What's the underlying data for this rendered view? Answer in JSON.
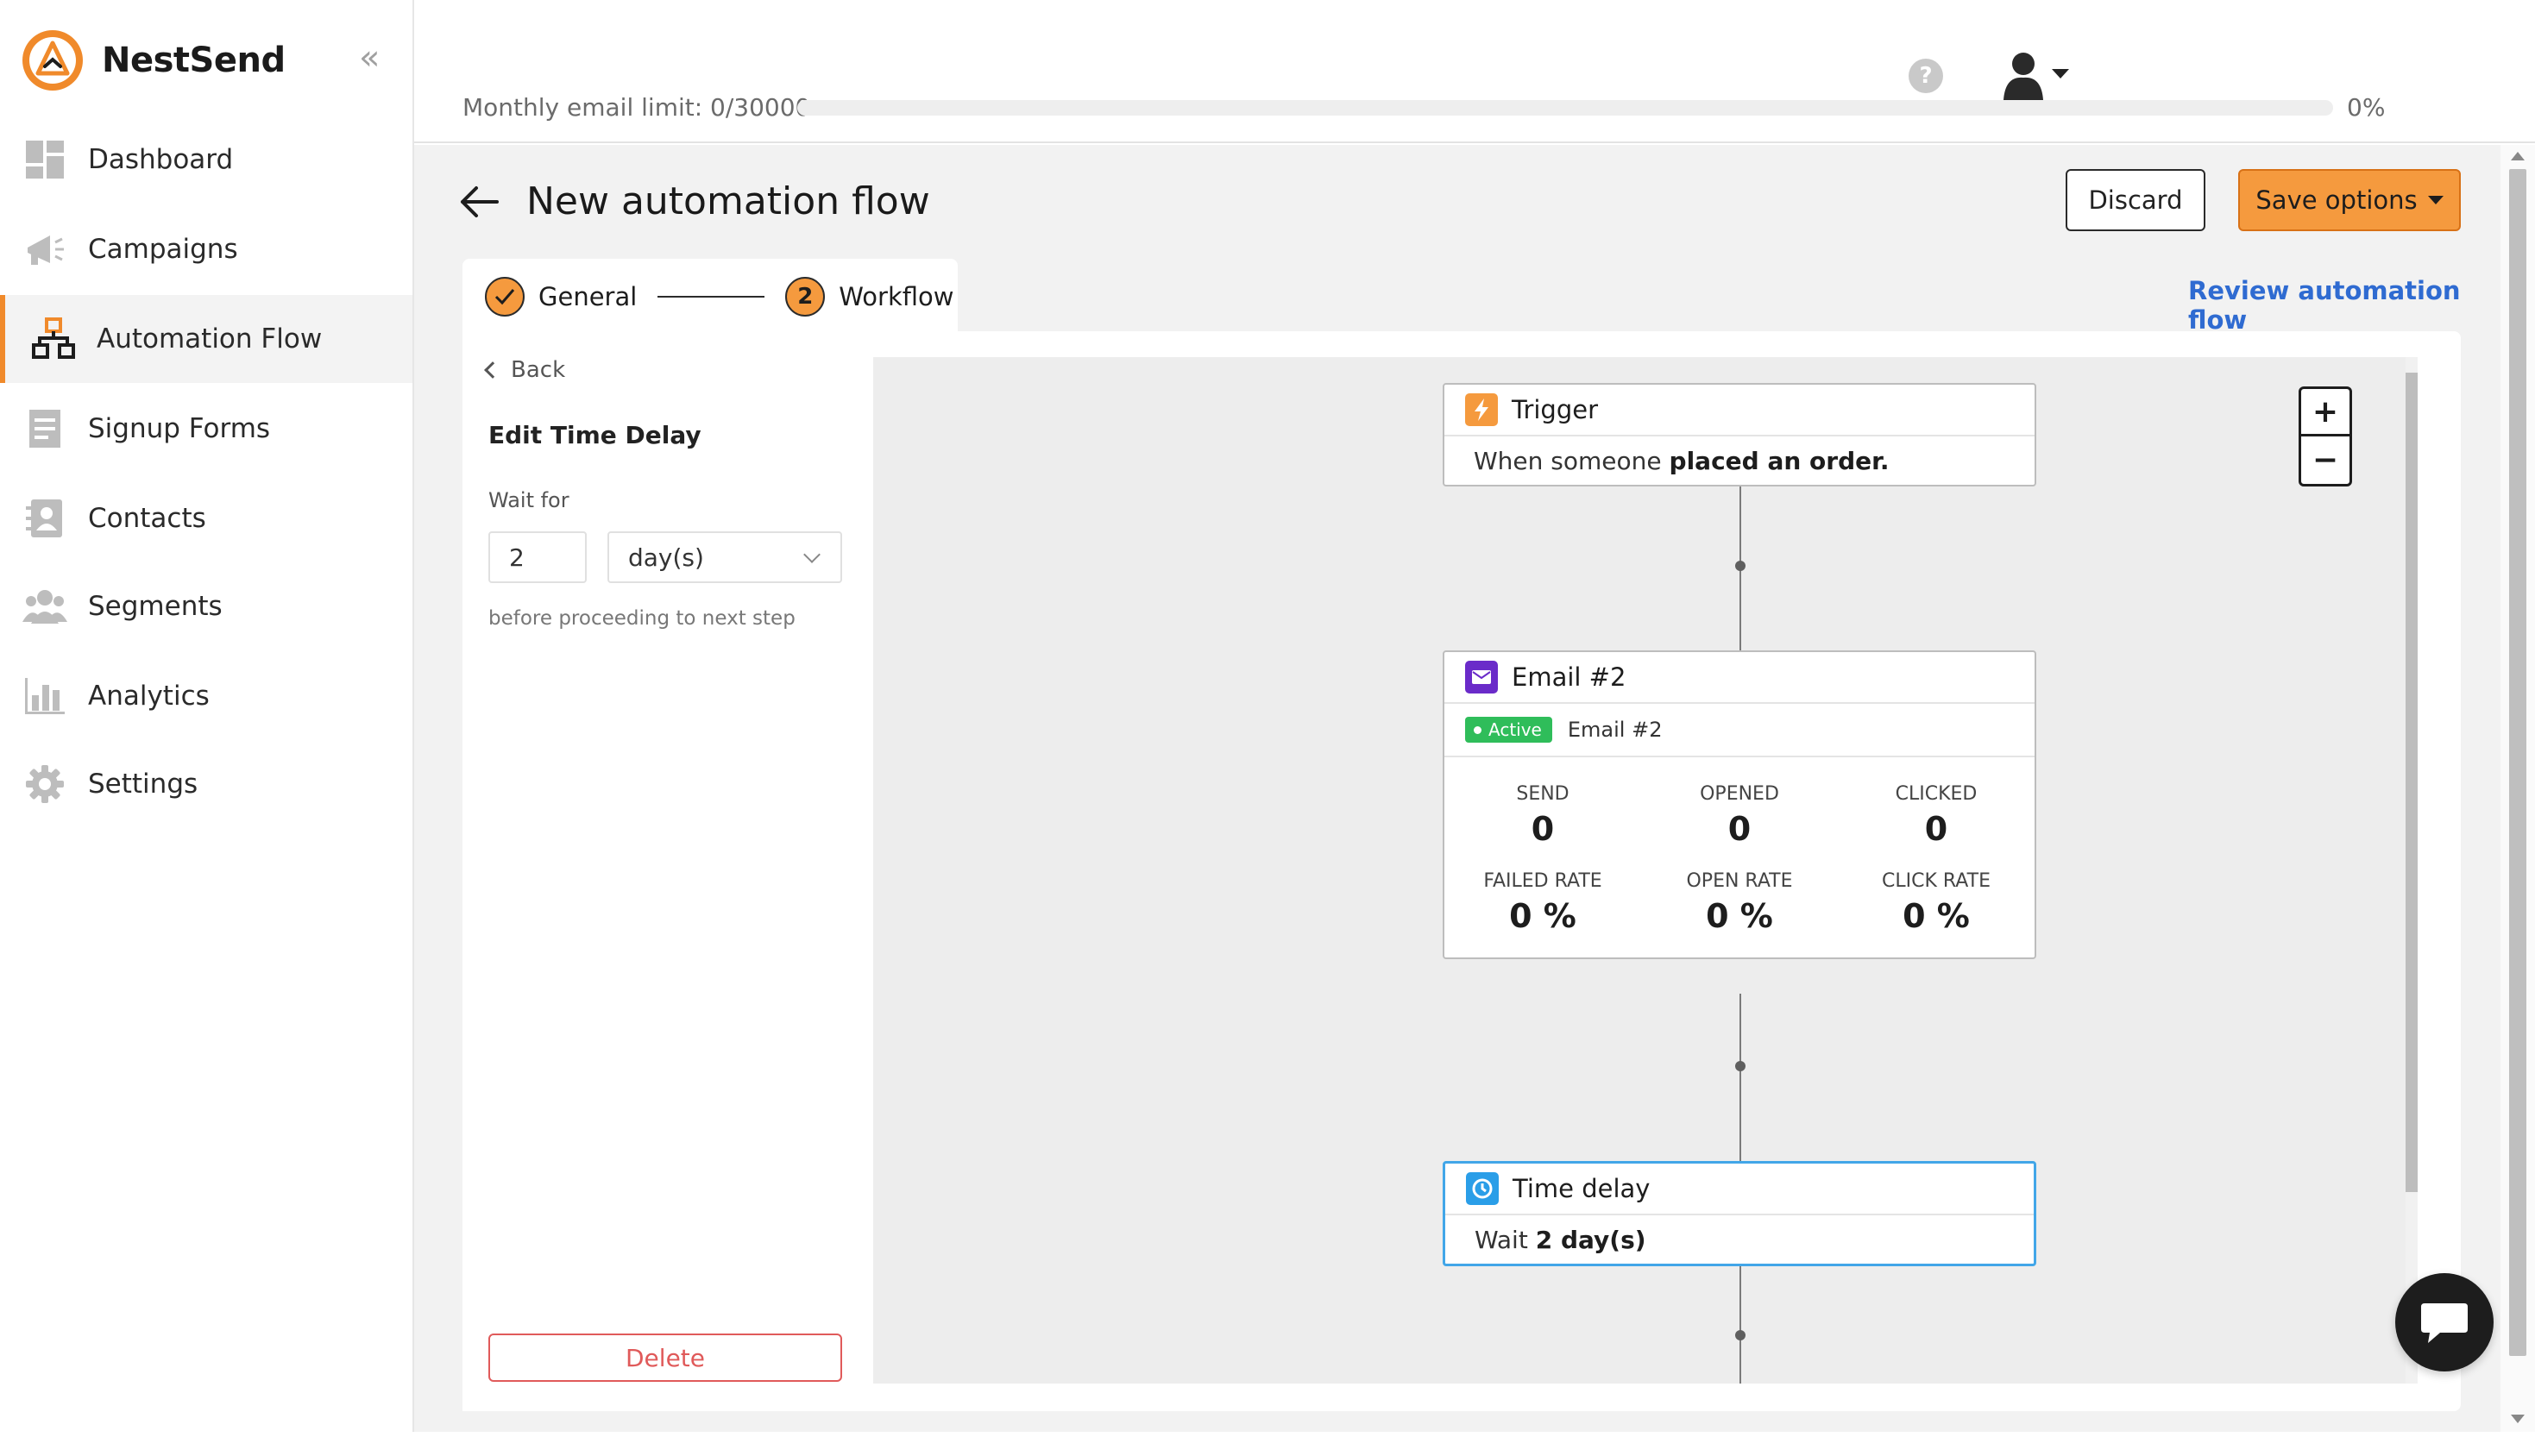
{
  "brand": {
    "name": "NestSend",
    "collapse_icon": "«"
  },
  "sidebar": {
    "items": [
      {
        "label": "Dashboard",
        "icon": "dashboard-icon",
        "active": false
      },
      {
        "label": "Campaigns",
        "icon": "megaphone-icon",
        "active": false
      },
      {
        "label": "Automation Flow",
        "icon": "flowchart-icon",
        "active": true
      },
      {
        "label": "Signup Forms",
        "icon": "form-icon",
        "active": false
      },
      {
        "label": "Contacts",
        "icon": "contact-book-icon",
        "active": false
      },
      {
        "label": "Segments",
        "icon": "users-icon",
        "active": false
      },
      {
        "label": "Analytics",
        "icon": "bar-chart-icon",
        "active": false
      },
      {
        "label": "Settings",
        "icon": "gear-icon",
        "active": false
      }
    ]
  },
  "topbar": {
    "limit_label": "Monthly email limit: 0/30000",
    "limit_percent_text": "0%",
    "limit_fraction": 0,
    "help_icon": "?"
  },
  "header": {
    "title": "New automation flow",
    "discard_label": "Discard",
    "save_label": "Save options"
  },
  "stepper": {
    "steps": [
      {
        "label": "General",
        "state": "complete"
      },
      {
        "label": "Workflow",
        "state": "current",
        "number": "2"
      }
    ],
    "review_link": "Review automation flow"
  },
  "panel": {
    "back_label": "Back",
    "title": "Edit Time Delay",
    "wait_label": "Wait for",
    "wait_value": "2",
    "unit_value": "day(s)",
    "help_text": "before proceeding to next step",
    "delete_label": "Delete"
  },
  "flow": {
    "trigger": {
      "title": "Trigger",
      "body_prefix": "When someone ",
      "body_bold": "placed an order."
    },
    "email": {
      "title": "Email #2",
      "badge": "Active",
      "subtitle": "Email #2",
      "stats": [
        {
          "label": "SEND",
          "value": "0"
        },
        {
          "label": "OPENED",
          "value": "0"
        },
        {
          "label": "CLICKED",
          "value": "0"
        },
        {
          "label": "FAILED RATE",
          "value": "0 %"
        },
        {
          "label": "OPEN RATE",
          "value": "0 %"
        },
        {
          "label": "CLICK RATE",
          "value": "0 %"
        }
      ]
    },
    "delay": {
      "title": "Time delay",
      "body_prefix": "Wait ",
      "body_bold": "2 day(s)"
    }
  },
  "zoom": {
    "in_label": "+",
    "out_label": "−"
  },
  "colors": {
    "accent": "#f08a2b",
    "button_orange": "#f59a3e",
    "link_blue": "#2f6bd1",
    "selected_border": "#42a6e8",
    "active_green": "#2fbd5a",
    "danger": "#e05a5a",
    "email_purple": "#6a2bc9",
    "delay_blue": "#2a9ee8"
  }
}
